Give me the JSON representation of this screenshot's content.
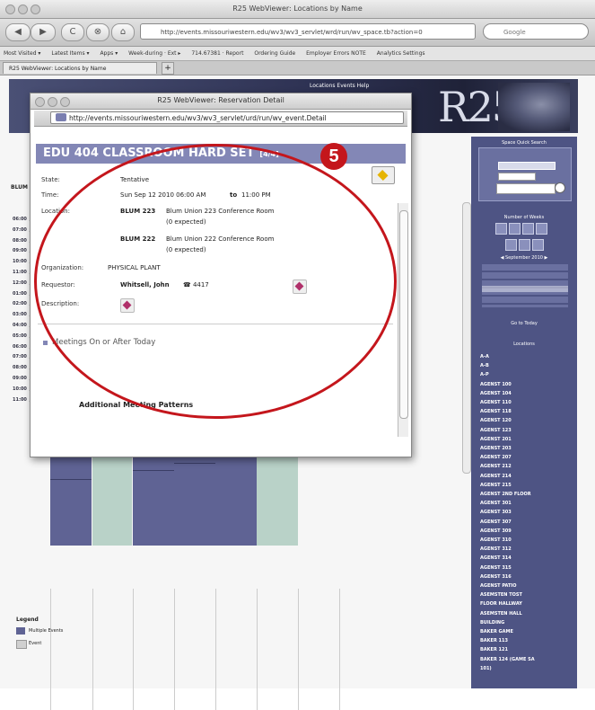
{
  "window": {
    "title": "R25 WebViewer: Locations by Name"
  },
  "toolbar": {
    "back": "◀",
    "forward": "▶",
    "reload": "C",
    "stop": "⊗",
    "home": "⌂",
    "url": "http://events.missouriwestern.edu/wv3/wv3_servlet/wrd/run/wv_space.tb?action=0",
    "search_placeholder": "Google"
  },
  "bookmarks": [
    "Most Visited ▾",
    "Latest Items ▾",
    "Apps ▾",
    "Week-during · Ext ▸",
    "714.67381 · Report",
    "Ordering Guide",
    "Employer Errors NOTE",
    "Analytics Settings"
  ],
  "tab": {
    "label": "R25 WebViewer: Locations by Name",
    "new_tab": "+"
  },
  "banner": {
    "links": "Locations   Events   Help"
  },
  "popup": {
    "title": "R25 WebViewer: Reservation Detail",
    "url": "http://events.missouriwestern.edu/wv3/wv3_servlet/urd/run/wv_event.Detail",
    "header": "EDU 404 CLASSROOM HARD SET",
    "count": "[4/4]",
    "state_label": "State:",
    "state_value": "Tentative",
    "time_label": "Time:",
    "time_value": "Sun Sep 12 2010 06:00 AM",
    "time_to": "to",
    "time_end": "11:00 PM",
    "location_label": "Location:",
    "locations": [
      {
        "room": "BLUM 223",
        "desc": "Blum Union 223 Conference Room",
        "expected": "(0 expected)"
      },
      {
        "room": "BLUM 222",
        "desc": "Blum Union 222 Conference Room",
        "expected": "(0 expected)"
      }
    ],
    "organization_label": "Organization:",
    "organization_value": "PHYSICAL PLANT",
    "requestor_label": "Requestor:",
    "requestor_value": "Whitsell, John",
    "phone": "☎ 4417",
    "description_label": "Description:",
    "meetings_label": "Meetings On or After Today",
    "additional_label": "Additional Meeting Patterns"
  },
  "grid": {
    "times": [
      "06:00",
      "07:00",
      "08:00",
      "09:00",
      "10:00",
      "11:00",
      "12:00",
      "01:00",
      "02:00",
      "03:00",
      "04:00",
      "05:00",
      "06:00",
      "07:00",
      "08:00",
      "09:00",
      "10:00",
      "11:00"
    ]
  },
  "sidebar": {
    "quick_search": "Space Quick Search",
    "display_label": "Number of Weeks",
    "calendar_title": "◀ September 2010 ▶",
    "go_today": "Go to Today",
    "locations_title": "Locations",
    "locations": [
      "A-A",
      "A-B",
      "A-P",
      "AGENST 100",
      "AGENST 104",
      "AGENST 110",
      "AGENST 118",
      "AGENST 120",
      "AGENST 123",
      "AGENST 201",
      "AGENST 203",
      "AGENST 207",
      "AGENST 212",
      "AGENST 214",
      "AGENST 215",
      "AGENST 2ND FLOOR",
      "AGENST 301",
      "AGENST 303",
      "AGENST 307",
      "AGENST 309",
      "AGENST 310",
      "AGENST 312",
      "AGENST 314",
      "AGENST 315",
      "AGENST 316",
      "AGENST PATIO",
      "ASEMSTEN TOST",
      "FLOOR HALLWAY",
      "ASEMSTEN HALL",
      "BUILDING",
      "BAKER GAME",
      "BAKER 113",
      "BAKER 121",
      "BAKER 124 (GAME SA",
      "101)"
    ]
  },
  "legend": {
    "title": "Legend",
    "items": [
      "Multiple Events",
      "Event"
    ]
  },
  "annotation": {
    "badge": "5"
  },
  "colors": {
    "accent": "#c4161c",
    "event": "#5f6394",
    "multi": "#b9d2c8",
    "sidebar": "#4e5484"
  }
}
